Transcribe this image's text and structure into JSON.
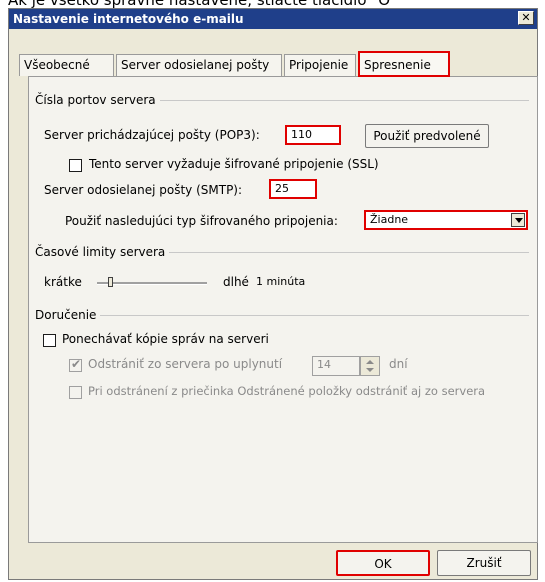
{
  "caption": "Ak je všetko správne nastavené, stlačte tlačidlo \"O",
  "dialog": {
    "title": "Nastavenie internetového e-mailu",
    "close_glyph": "✕"
  },
  "tabs": [
    {
      "label": "Všeobecné",
      "active": false
    },
    {
      "label": "Server odosielanej pošty",
      "active": false
    },
    {
      "label": "Pripojenie",
      "active": false
    },
    {
      "label": "Spresnenie",
      "active": true
    }
  ],
  "server_ports": {
    "group_label": "Čísla portov servera",
    "incoming_label": "Server prichádzajúcej pošty (POP3):",
    "incoming_value": "110",
    "use_defaults_button": "Použiť predvolené",
    "ssl_checkbox_label": "Tento server vyžaduje šifrované pripojenie (SSL)",
    "ssl_checked": false,
    "outgoing_label": "Server odosielanej pošty (SMTP):",
    "outgoing_value": "25",
    "encryption_label": "Použiť nasledujúci typ šifrovaného pripojenia:",
    "encryption_value": "Žiadne"
  },
  "timeouts": {
    "group_label": "Časové limity servera",
    "short_label": "krátke",
    "long_label": "dlhé",
    "value_label": "1 minúta",
    "slider_position": 0.1
  },
  "delivery": {
    "group_label": "Doručenie",
    "keep_copy_label": "Ponechávať kópie správ na serveri",
    "keep_copy_checked": false,
    "remove_after_label": "Odstrániť zo servera po uplynutí",
    "remove_after_checked": true,
    "days_value": "14",
    "days_unit": "dní",
    "remove_deleted_label": "Pri odstránení z priečinka Odstránené položky odstrániť aj zo servera",
    "remove_deleted_checked": false
  },
  "buttons": {
    "ok": "OK",
    "cancel": "Zrušiť"
  },
  "colors": {
    "highlight": "#e00000",
    "titlebar": "#1f3f8a",
    "dialog_bg": "#ece9d8"
  }
}
